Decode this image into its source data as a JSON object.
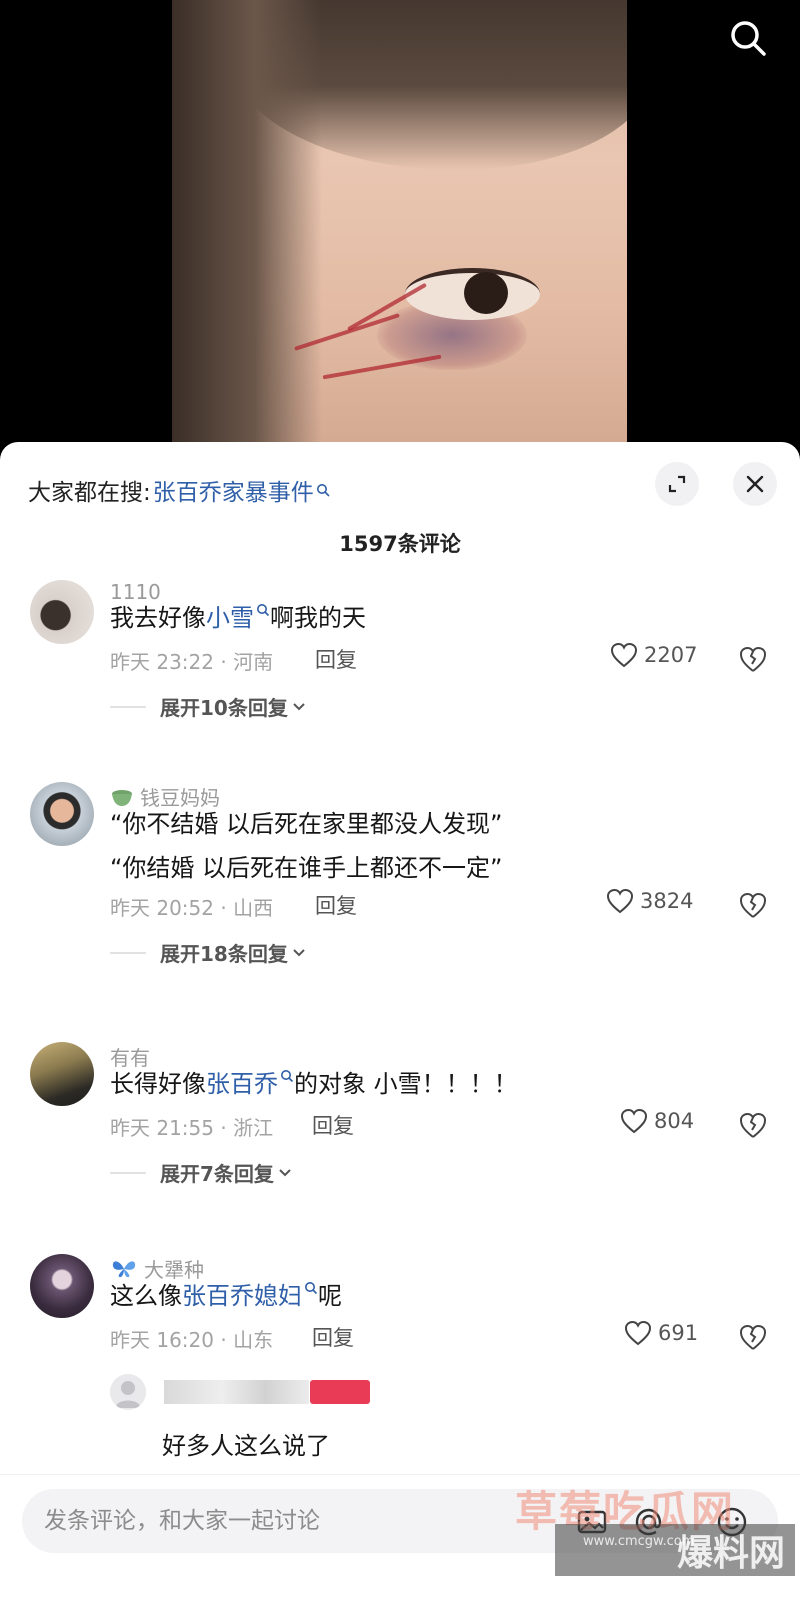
{
  "video": {
    "search_icon": "search-icon"
  },
  "header": {
    "search_prefix": "大家都在搜:",
    "search_term": "张百乔家暴事件",
    "expand_icon": "expand-icon",
    "close_icon": "close-icon"
  },
  "comment_count": "1597条评论",
  "comments": [
    {
      "user": "1110",
      "badge": "",
      "text_before": "我去好像",
      "text_link": "小雪",
      "text_after": "啊我的天",
      "time_loc": "昨天 23:22 · 河南",
      "reply_label": "回复",
      "likes": "2207",
      "expand": "展开10条回复"
    },
    {
      "user": "钱豆妈妈",
      "badge": "tea-cup-icon",
      "line1": "“你不结婚 以后死在家里都没人发现”",
      "line2": "“你结婚 以后死在谁手上都还不一定”",
      "time_loc": "昨天 20:52 · 山西",
      "reply_label": "回复",
      "likes": "3824",
      "expand": "展开18条回复"
    },
    {
      "user": "有有",
      "badge": "",
      "text_before": "长得好像",
      "text_link": "张百乔",
      "text_after": "的对象  小雪！！！！",
      "time_loc": "昨天 21:55 · 浙江",
      "reply_label": "回复",
      "likes": "804",
      "expand": "展开7条回复"
    },
    {
      "user": "大犟种",
      "badge": "butterfly-icon",
      "text_before": "这么像",
      "text_link": "张百乔媳妇",
      "text_after": "呢",
      "time_loc": "昨天 16:20 · 山东",
      "reply_label": "回复",
      "likes": "691",
      "sub_reply": "好多人这么说了"
    }
  ],
  "input": {
    "placeholder": "发条评论，和大家一起讨论"
  },
  "watermark": {
    "line1": "草莓吃瓜网",
    "line2": "爆料网",
    "url": "www.cmcgw.com"
  },
  "colors": {
    "link": "#2f5fa8",
    "sheet_bg": "#ffffff",
    "video_bg": "#000000"
  }
}
